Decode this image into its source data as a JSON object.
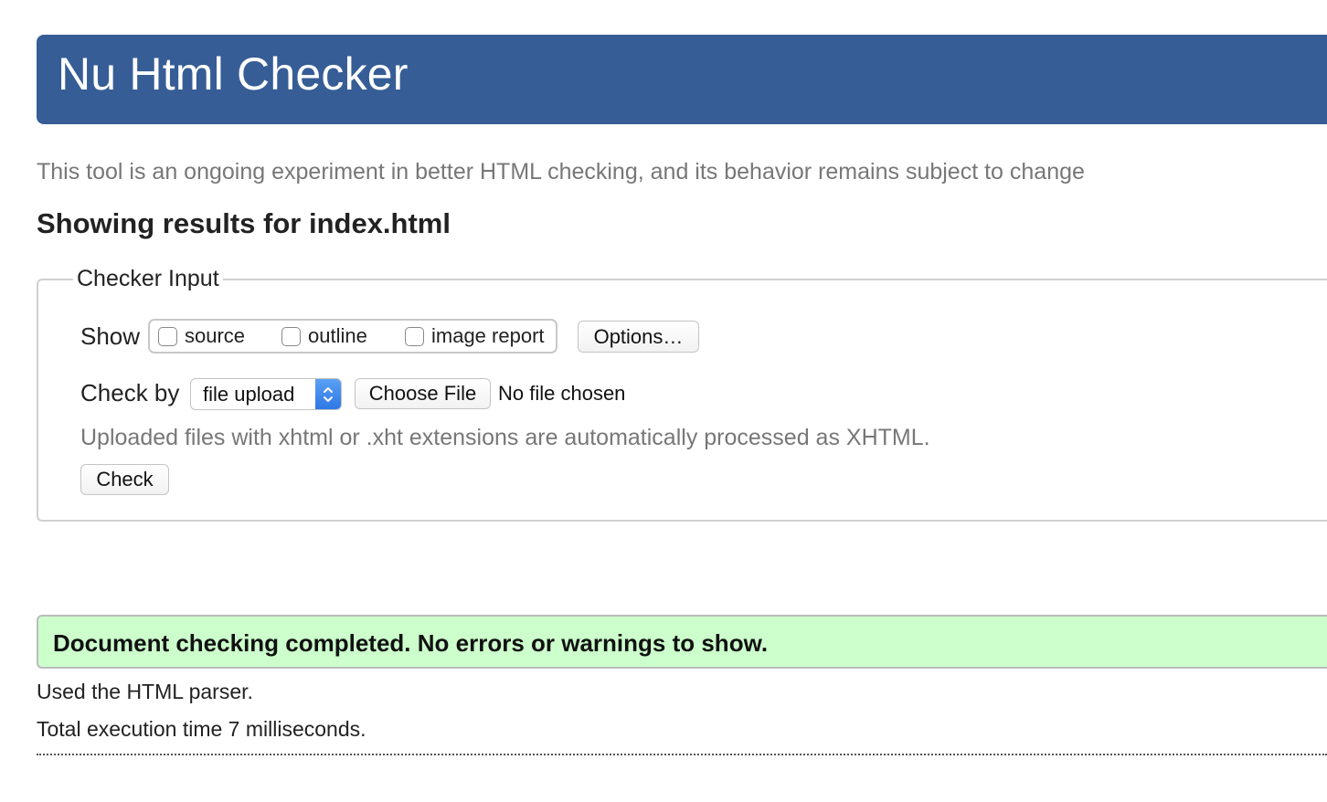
{
  "header": {
    "title": "Nu Html Checker",
    "background_color": "#365d95"
  },
  "intro_text": "This tool is an ongoing experiment in better HTML checking, and its behavior remains subject to change",
  "results_heading": "Showing results for index.html",
  "checker_input": {
    "legend": "Checker Input",
    "show": {
      "label": "Show",
      "options": [
        {
          "label": "source",
          "checked": false
        },
        {
          "label": "outline",
          "checked": false
        },
        {
          "label": "image report",
          "checked": false
        }
      ],
      "options_button": "Options…"
    },
    "check_by": {
      "label": "Check by",
      "selected": "file upload",
      "choose_file_button": "Choose File",
      "file_status": "No file chosen"
    },
    "hint": "Uploaded files with xhtml or .xht extensions are automatically processed as XHTML.",
    "check_button": "Check"
  },
  "result": {
    "message": "Document checking completed. No errors or warnings to show.",
    "background_color": "#ccffcc"
  },
  "details": {
    "parser": "Used the HTML parser.",
    "execution_time": "Total execution time 7 milliseconds."
  }
}
